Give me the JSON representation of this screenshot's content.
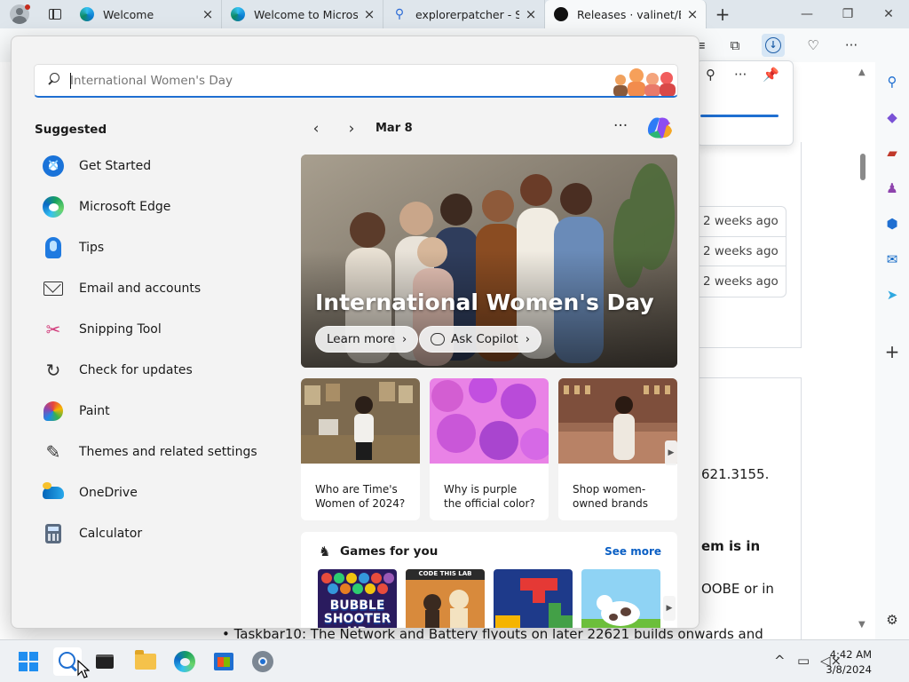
{
  "browser": {
    "tabs": [
      {
        "title": "Welcome",
        "favicon": "edge-icon",
        "active": false
      },
      {
        "title": "Welcome to Microsof",
        "favicon": "edge-icon",
        "active": false
      },
      {
        "title": "explorerpatcher - Sea",
        "favicon": "search-icon",
        "active": false
      },
      {
        "title": "Releases · valinet/Expl",
        "favicon": "github-icon",
        "active": true
      }
    ],
    "new_tab": "+",
    "window_controls": {
      "minimize": "—",
      "maximize": "❐",
      "close": "✕"
    }
  },
  "page_behind": {
    "release_times": [
      "2 weeks ago",
      "2 weeks ago",
      "2 weeks ago"
    ],
    "text_fragments": [
      "621.3155.",
      "em is in",
      "OOBE or in"
    ],
    "bullet": "Taskbar10: The Network and Battery flyouts on later 22621 builds onwards and"
  },
  "search": {
    "value": "",
    "placeholder": "International Women's Day"
  },
  "suggested": {
    "title": "Suggested",
    "items": [
      {
        "label": "Get Started",
        "icon": "get-started-icon"
      },
      {
        "label": "Microsoft Edge",
        "icon": "edge-icon"
      },
      {
        "label": "Tips",
        "icon": "tips-icon"
      },
      {
        "label": "Email and accounts",
        "icon": "mail-icon"
      },
      {
        "label": "Snipping Tool",
        "icon": "snipping-tool-icon"
      },
      {
        "label": "Check for updates",
        "icon": "refresh-icon"
      },
      {
        "label": "Paint",
        "icon": "paint-icon"
      },
      {
        "label": "Themes and related settings",
        "icon": "brush-icon"
      },
      {
        "label": "OneDrive",
        "icon": "onedrive-icon"
      },
      {
        "label": "Calculator",
        "icon": "calculator-icon"
      }
    ]
  },
  "highlights": {
    "prev": "‹",
    "next": "›",
    "date": "Mar 8",
    "more": "···",
    "hero": {
      "title": "International Women's Day",
      "learn_more": "Learn more",
      "ask_copilot": "Ask Copilot"
    },
    "cards": [
      {
        "caption": "Who are Time's Women of 2024?"
      },
      {
        "caption": "Why is purple the official color?"
      },
      {
        "caption": "Shop women-owned brands"
      }
    ],
    "games": {
      "title": "Games for you",
      "see_more": "See more",
      "tiles": [
        {
          "name": "BUBBLE SHOOTER HD"
        },
        {
          "name": "CODE THIS LAB"
        },
        {
          "name": ""
        },
        {
          "name": ""
        }
      ]
    }
  },
  "taskbar": {
    "time": "4:42 AM",
    "date": "3/8/2024",
    "tray_chevron": "^"
  },
  "colors": {
    "accent": "#1f6fd1",
    "flyout_bg": "#f3f3f3",
    "link": "#0a5fc4"
  }
}
